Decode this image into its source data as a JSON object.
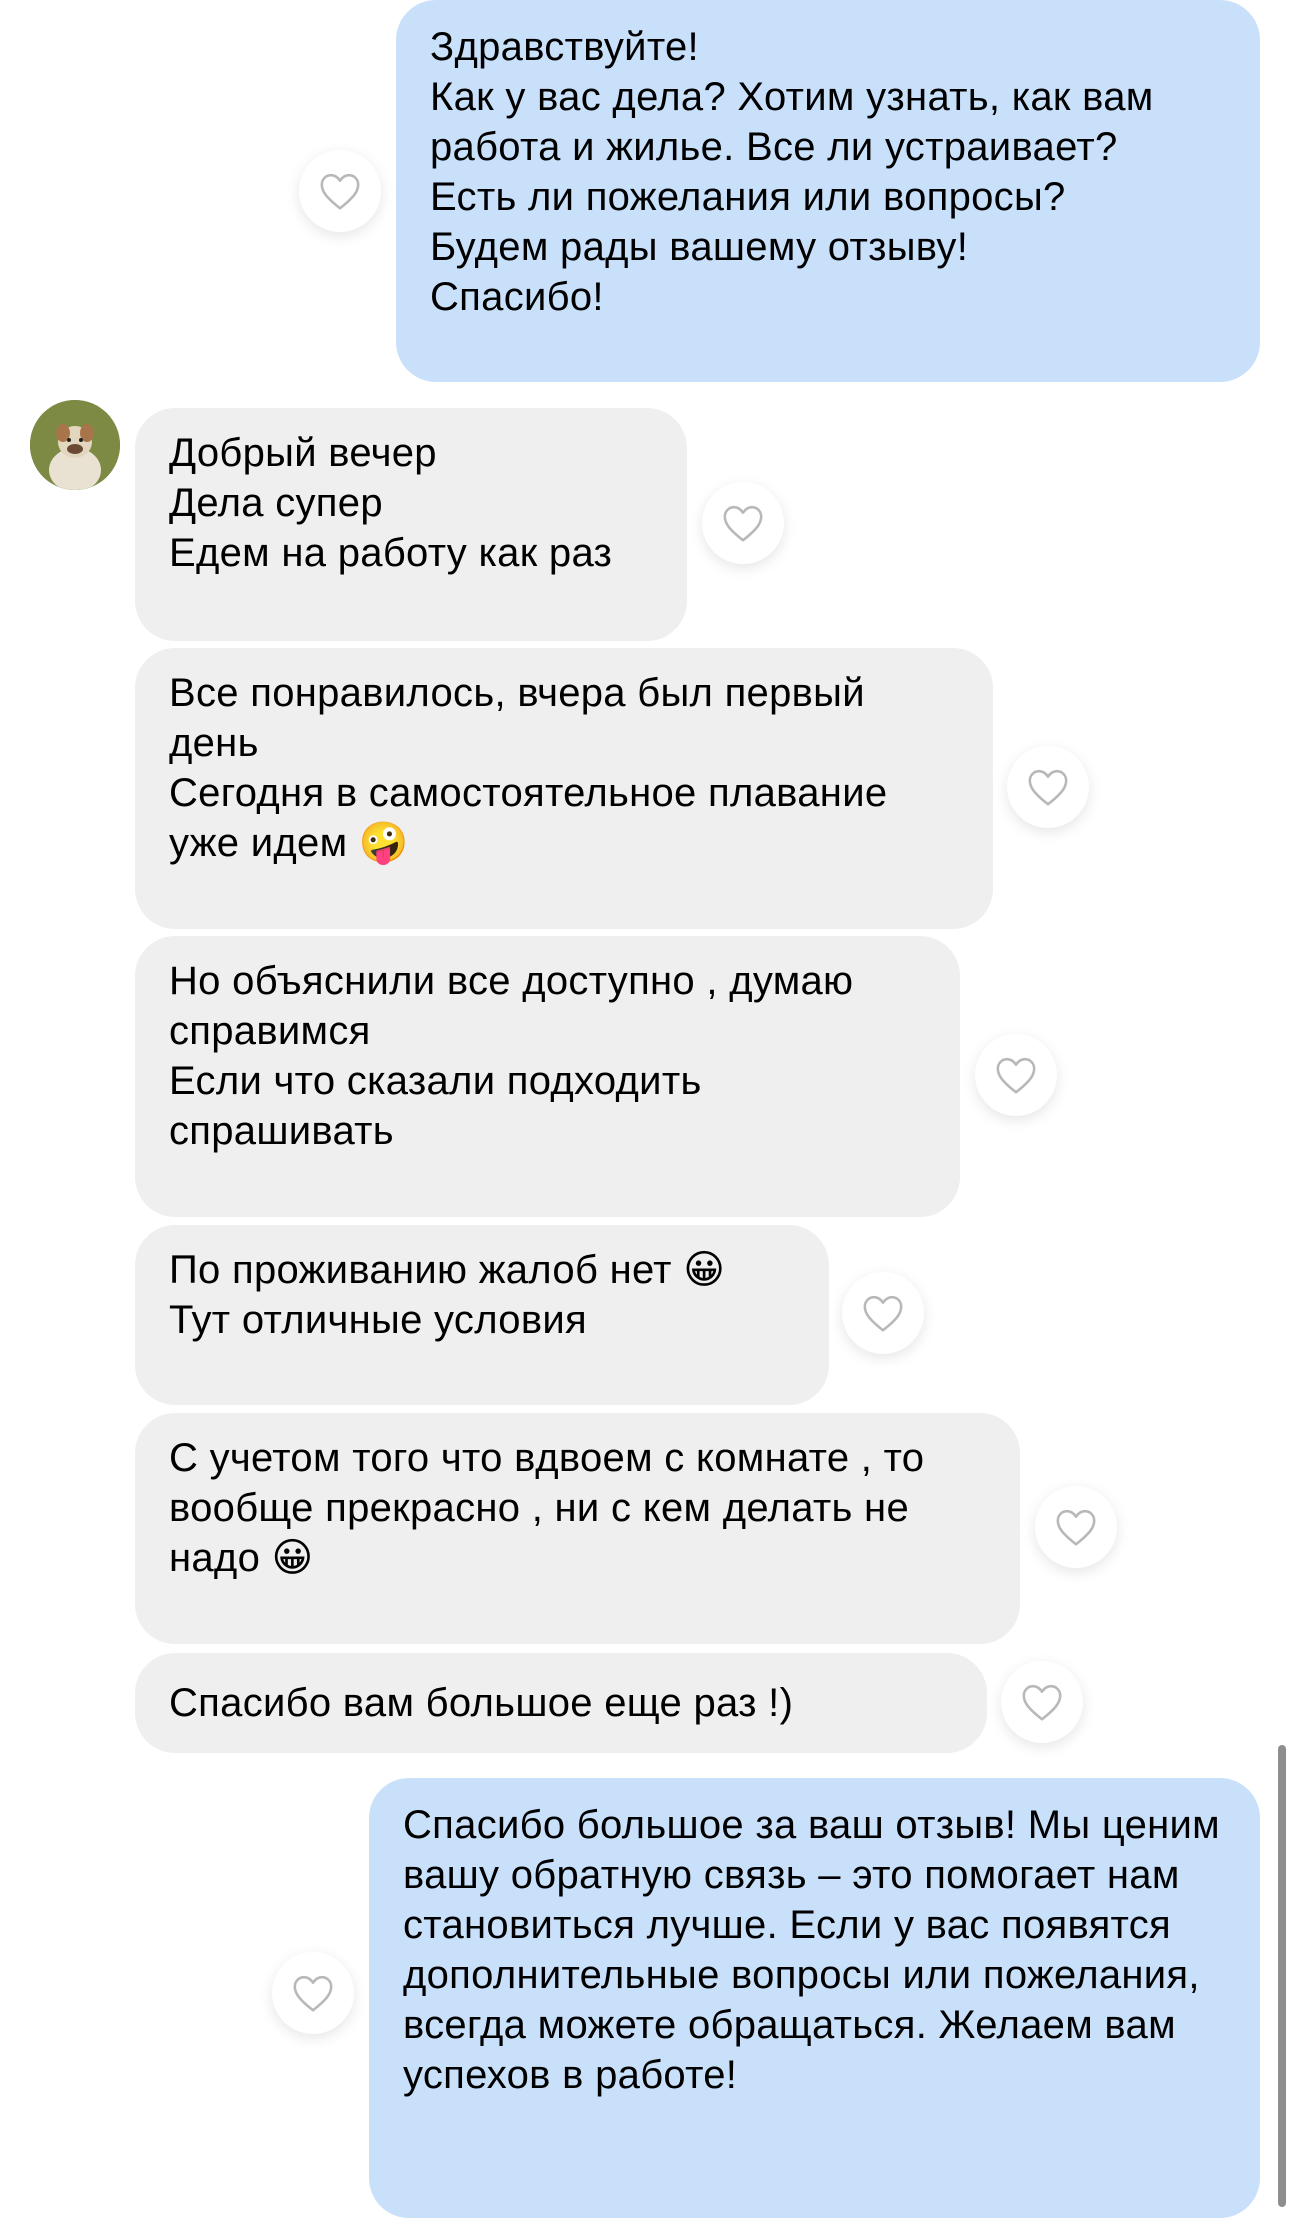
{
  "messages": [
    {
      "direction": "outgoing",
      "text": "Здравствуйте!\nКак у вас дела? Хотим узнать, как вам работа и жилье. Все ли устраивает?\nЕсть ли пожелания или вопросы?\nБудем рады вашему отзыву!\nСпасибо!"
    },
    {
      "direction": "incoming",
      "text": "Добрый вечер\nДела супер\nЕдем на работу как раз"
    },
    {
      "direction": "incoming",
      "text": "Все понравилось, вчера был первый день\nСегодня в самостоятельное плавание уже идем 🤪"
    },
    {
      "direction": "incoming",
      "text": "Но объяснили все доступно , думаю справимся\nЕсли что сказали подходить спрашивать"
    },
    {
      "direction": "incoming",
      "text": "По проживанию жалоб нет 😀\nТут отличные условия"
    },
    {
      "direction": "incoming",
      "text": "С учетом   того что вдвоем с комнате , то вообще прекрасно , ни с кем делать не надо 😀"
    },
    {
      "direction": "incoming",
      "text": "Спасибо вам большое еще раз !)"
    },
    {
      "direction": "outgoing",
      "text": "Спасибо большое за ваш отзыв! Мы ценим вашу обратную связь – это помогает нам становиться лучше. Если у вас появятся дополнительные вопросы или пожелания, всегда можете обращаться. Желаем вам успехов в работе!"
    }
  ],
  "icons": {
    "like": "heart-outline-icon",
    "avatar": "bulldog-avatar"
  },
  "colors": {
    "outgoing_bubble": "#c9e0fb",
    "incoming_bubble": "#efefef",
    "heart_stroke": "#b8b8b8",
    "background": "#ffffff"
  }
}
